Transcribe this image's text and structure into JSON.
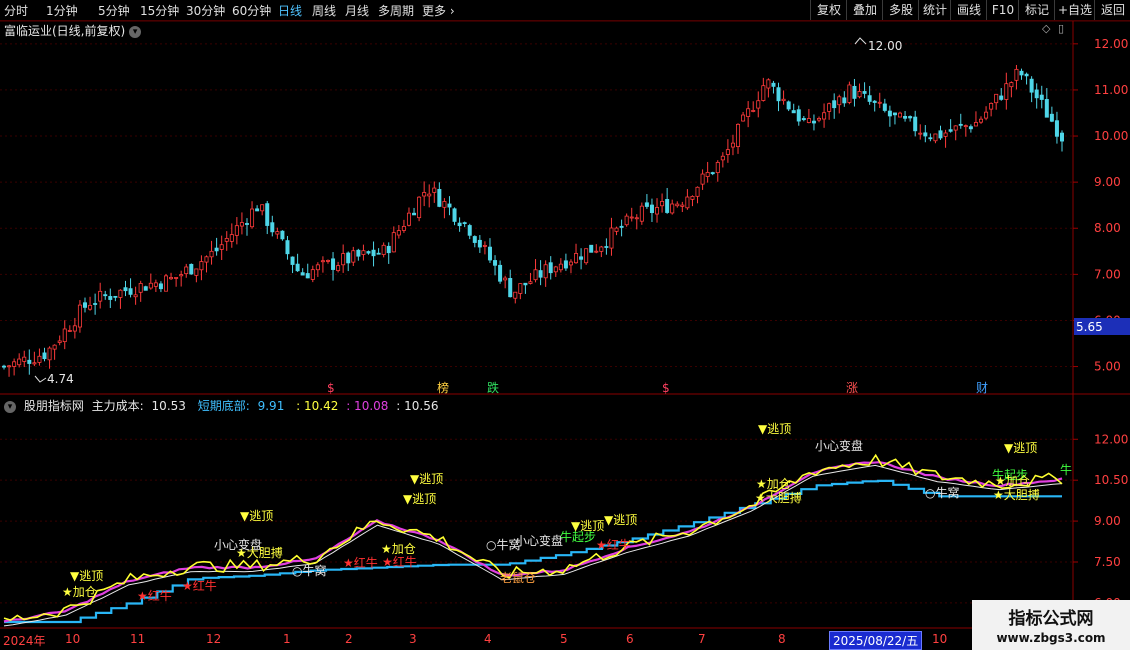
{
  "toolbar": {
    "periods": [
      "分时",
      "1分钟",
      "5分钟",
      "15分钟",
      "30分钟",
      "60分钟",
      "日线",
      "周线",
      "月线",
      "多周期",
      "更多"
    ],
    "active_period": "日线",
    "right_buttons": [
      "复权",
      "叠加",
      "多股",
      "统计",
      "画线",
      "F10",
      "标记",
      "+自选",
      "返回"
    ]
  },
  "main_chart": {
    "title": "富临运业(日线,前复权)",
    "y_ticks": [
      "12.00",
      "11.00",
      "10.00",
      "9.00",
      "8.00",
      "7.00",
      "6.00",
      "5.00"
    ],
    "current_price": "5.65",
    "high_label": "12.00",
    "low_label": "4.74",
    "event_markers": [
      "$",
      "榜",
      "跌",
      "$",
      "涨",
      "财"
    ]
  },
  "indicator": {
    "name": "股朋指标网",
    "main_cost_label": "主力成本:",
    "main_cost_value": "10.53",
    "short_bottom_label": "短期底部:",
    "short_bottom_value": "9.91",
    "v3": ": 10.42",
    "v4": ": 10.08",
    "v5": ": 10.56",
    "y_ticks": [
      "12.00",
      "10.50",
      "9.00",
      "7.50",
      "6.00"
    ],
    "signals": {
      "escape_top": "▼逃顶",
      "add_position": "★加仓",
      "red_bull": "★红牛",
      "bold_bet": "★大胆搏",
      "bull_nest": "○牛窝",
      "careful": "小心变盘",
      "rat_position": "老鼠仓",
      "bull_start": "牛起步",
      "bull": "牛"
    }
  },
  "date_axis": {
    "labels": [
      "2024年",
      "10",
      "11",
      "12",
      "1",
      "2",
      "3",
      "4",
      "5",
      "6",
      "7",
      "8",
      "10"
    ],
    "highlight": "2025/08/22/五"
  },
  "watermark": {
    "title": "指标公式网",
    "url": "www.zbgs3.com"
  },
  "chart_data": [
    {
      "type": "candlestick",
      "title": "富临运业(日线,前复权)",
      "ylim": [
        4.6,
        12.3
      ],
      "x_labels": [
        "2024年",
        "10",
        "11",
        "12",
        "1",
        "2",
        "3",
        "4",
        "5",
        "6",
        "7",
        "8",
        "10"
      ],
      "close_approx": [
        5.0,
        5.3,
        6.4,
        6.7,
        6.9,
        7.5,
        8.5,
        7.0,
        7.3,
        7.5,
        8.9,
        8.0,
        6.6,
        7.2,
        7.6,
        8.3,
        8.6,
        9.5,
        11.2,
        10.2,
        11.0,
        10.4,
        10.0,
        10.3,
        11.4,
        10.0
      ]
    },
    {
      "type": "line",
      "title": "股朋指标网",
      "ylim": [
        5.3,
        13.0
      ],
      "series": [
        {
          "name": "主力成本",
          "values": [
            5.3,
            5.7,
            6.8,
            7.3,
            7.3,
            7.6,
            9.0,
            8.3,
            7.0,
            7.2,
            8.0,
            8.6,
            9.5,
            10.8,
            11.2,
            10.6,
            10.3,
            10.53
          ]
        },
        {
          "name": "短期底部",
          "values": [
            5.3,
            5.3,
            6.0,
            6.9,
            7.0,
            7.2,
            7.3,
            7.4,
            7.4,
            7.8,
            8.3,
            8.9,
            9.6,
            10.3,
            10.5,
            9.91,
            9.91,
            9.91
          ]
        }
      ]
    }
  ]
}
